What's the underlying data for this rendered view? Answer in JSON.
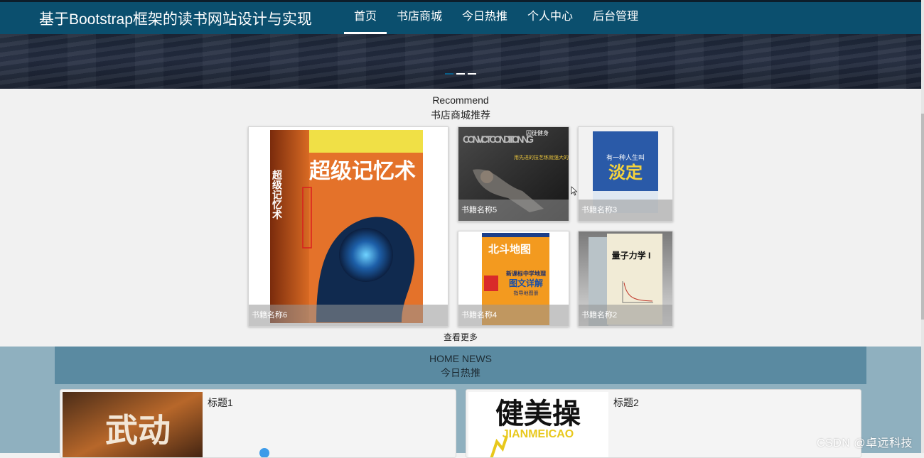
{
  "site": {
    "title": "基于Bootstrap框架的读书网站设计与实现"
  },
  "nav": {
    "items": [
      {
        "label": "首页",
        "active": true
      },
      {
        "label": "书店商城"
      },
      {
        "label": "今日热推"
      },
      {
        "label": "个人中心"
      },
      {
        "label": "后台管理"
      }
    ]
  },
  "carousel": {
    "slide_count": 3,
    "active_index": 0
  },
  "recommend": {
    "title_en": "Recommend",
    "title_cn": "书店商城推荐",
    "books": [
      {
        "name": "书籍名称6",
        "cover_text": "超级记忆术",
        "cover_side": "超级记忆术"
      },
      {
        "name": "书籍名称5",
        "cover_text": "CONVICT CONDITIONING",
        "cover_sub": "囚徒健身",
        "cover_tag": "用先进的技艺练就强大的生存实力"
      },
      {
        "name": "书籍名称3",
        "cover_text": "淡定",
        "cover_sub": "有一种人生叫"
      },
      {
        "name": "书籍名称4",
        "cover_text": "北斗地图",
        "cover_sub": "新课标中学地理",
        "cover_tag": "图文详解",
        "cover_small": "指导地图册"
      },
      {
        "name": "书籍名称2",
        "cover_text": "量子力学 I"
      }
    ],
    "more_label": "查看更多"
  },
  "news": {
    "title_en": "HOME NEWS",
    "title_cn": "今日热推",
    "items": [
      {
        "title": "标题1",
        "cover_text": "武动"
      },
      {
        "title": "标题2",
        "cover_text": "健美操",
        "cover_sub": "JIANMEICAO"
      }
    ]
  },
  "watermark": "CSDN @卓远科技",
  "colors": {
    "navbar": "#0b4f6e",
    "news_band": "#8fb0bf",
    "news_header": "#5a8aa1"
  }
}
